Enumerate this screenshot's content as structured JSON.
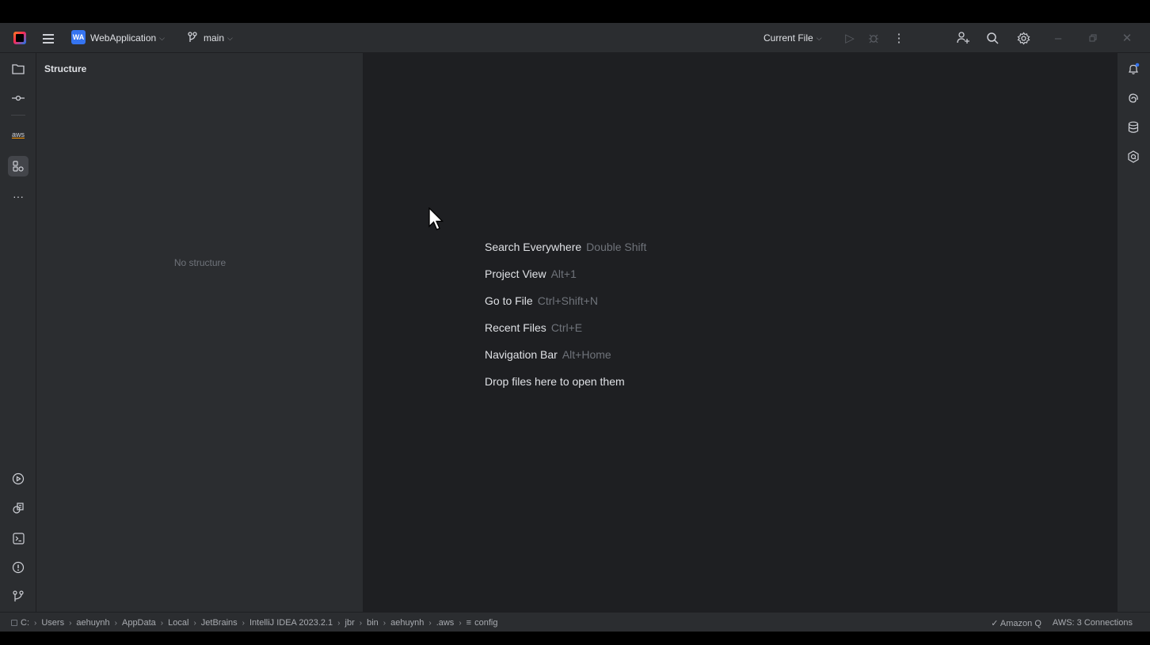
{
  "titlebar": {
    "project_badge": "WA",
    "project_name": "WebApplication",
    "branch": "main",
    "run_config": "Current File",
    "icons": [
      "intellij-logo",
      "main-menu-icon",
      "branch-icon",
      "run-icon",
      "debug-icon",
      "more-icon",
      "code-with-me-icon",
      "search-icon",
      "settings-icon",
      "minimize-icon",
      "restore-icon",
      "close-icon"
    ]
  },
  "left_stripe": {
    "top_icons": [
      "project-icon",
      "commit-icon",
      "aws-icon",
      "structure-icon",
      "more-tools-icon"
    ],
    "bottom_icons": [
      "run-services-icon",
      "build-icon",
      "terminal-icon",
      "problems-icon",
      "git-icon"
    ],
    "aws_label": "aws"
  },
  "structure": {
    "title": "Structure",
    "empty_text": "No structure"
  },
  "editor": {
    "tips": [
      {
        "action": "Search Everywhere",
        "shortcut": "Double Shift"
      },
      {
        "action": "Project View",
        "shortcut": "Alt+1"
      },
      {
        "action": "Go to File",
        "shortcut": "Ctrl+Shift+N"
      },
      {
        "action": "Recent Files",
        "shortcut": "Ctrl+E"
      },
      {
        "action": "Navigation Bar",
        "shortcut": "Alt+Home"
      },
      {
        "action": "Drop files here to open them",
        "shortcut": ""
      }
    ]
  },
  "right_stripe": {
    "icons": [
      "notifications-icon",
      "ai-assistant-icon",
      "database-icon",
      "amazon-q-icon"
    ]
  },
  "statusbar": {
    "breadcrumbs": [
      "C:",
      "Users",
      "aehuynh",
      "AppData",
      "Local",
      "JetBrains",
      "IntelliJ IDEA 2023.2.1",
      "jbr",
      "bin",
      "aehuynh",
      ".aws",
      "config"
    ],
    "amazon_q": "✓ Amazon Q",
    "aws_connections": "AWS: 3 Connections"
  },
  "colors": {
    "background": "#1e1f22",
    "panel": "#2b2d30",
    "text": "#dfe1e5",
    "muted": "#6f737a",
    "accent": "#3574f0"
  }
}
